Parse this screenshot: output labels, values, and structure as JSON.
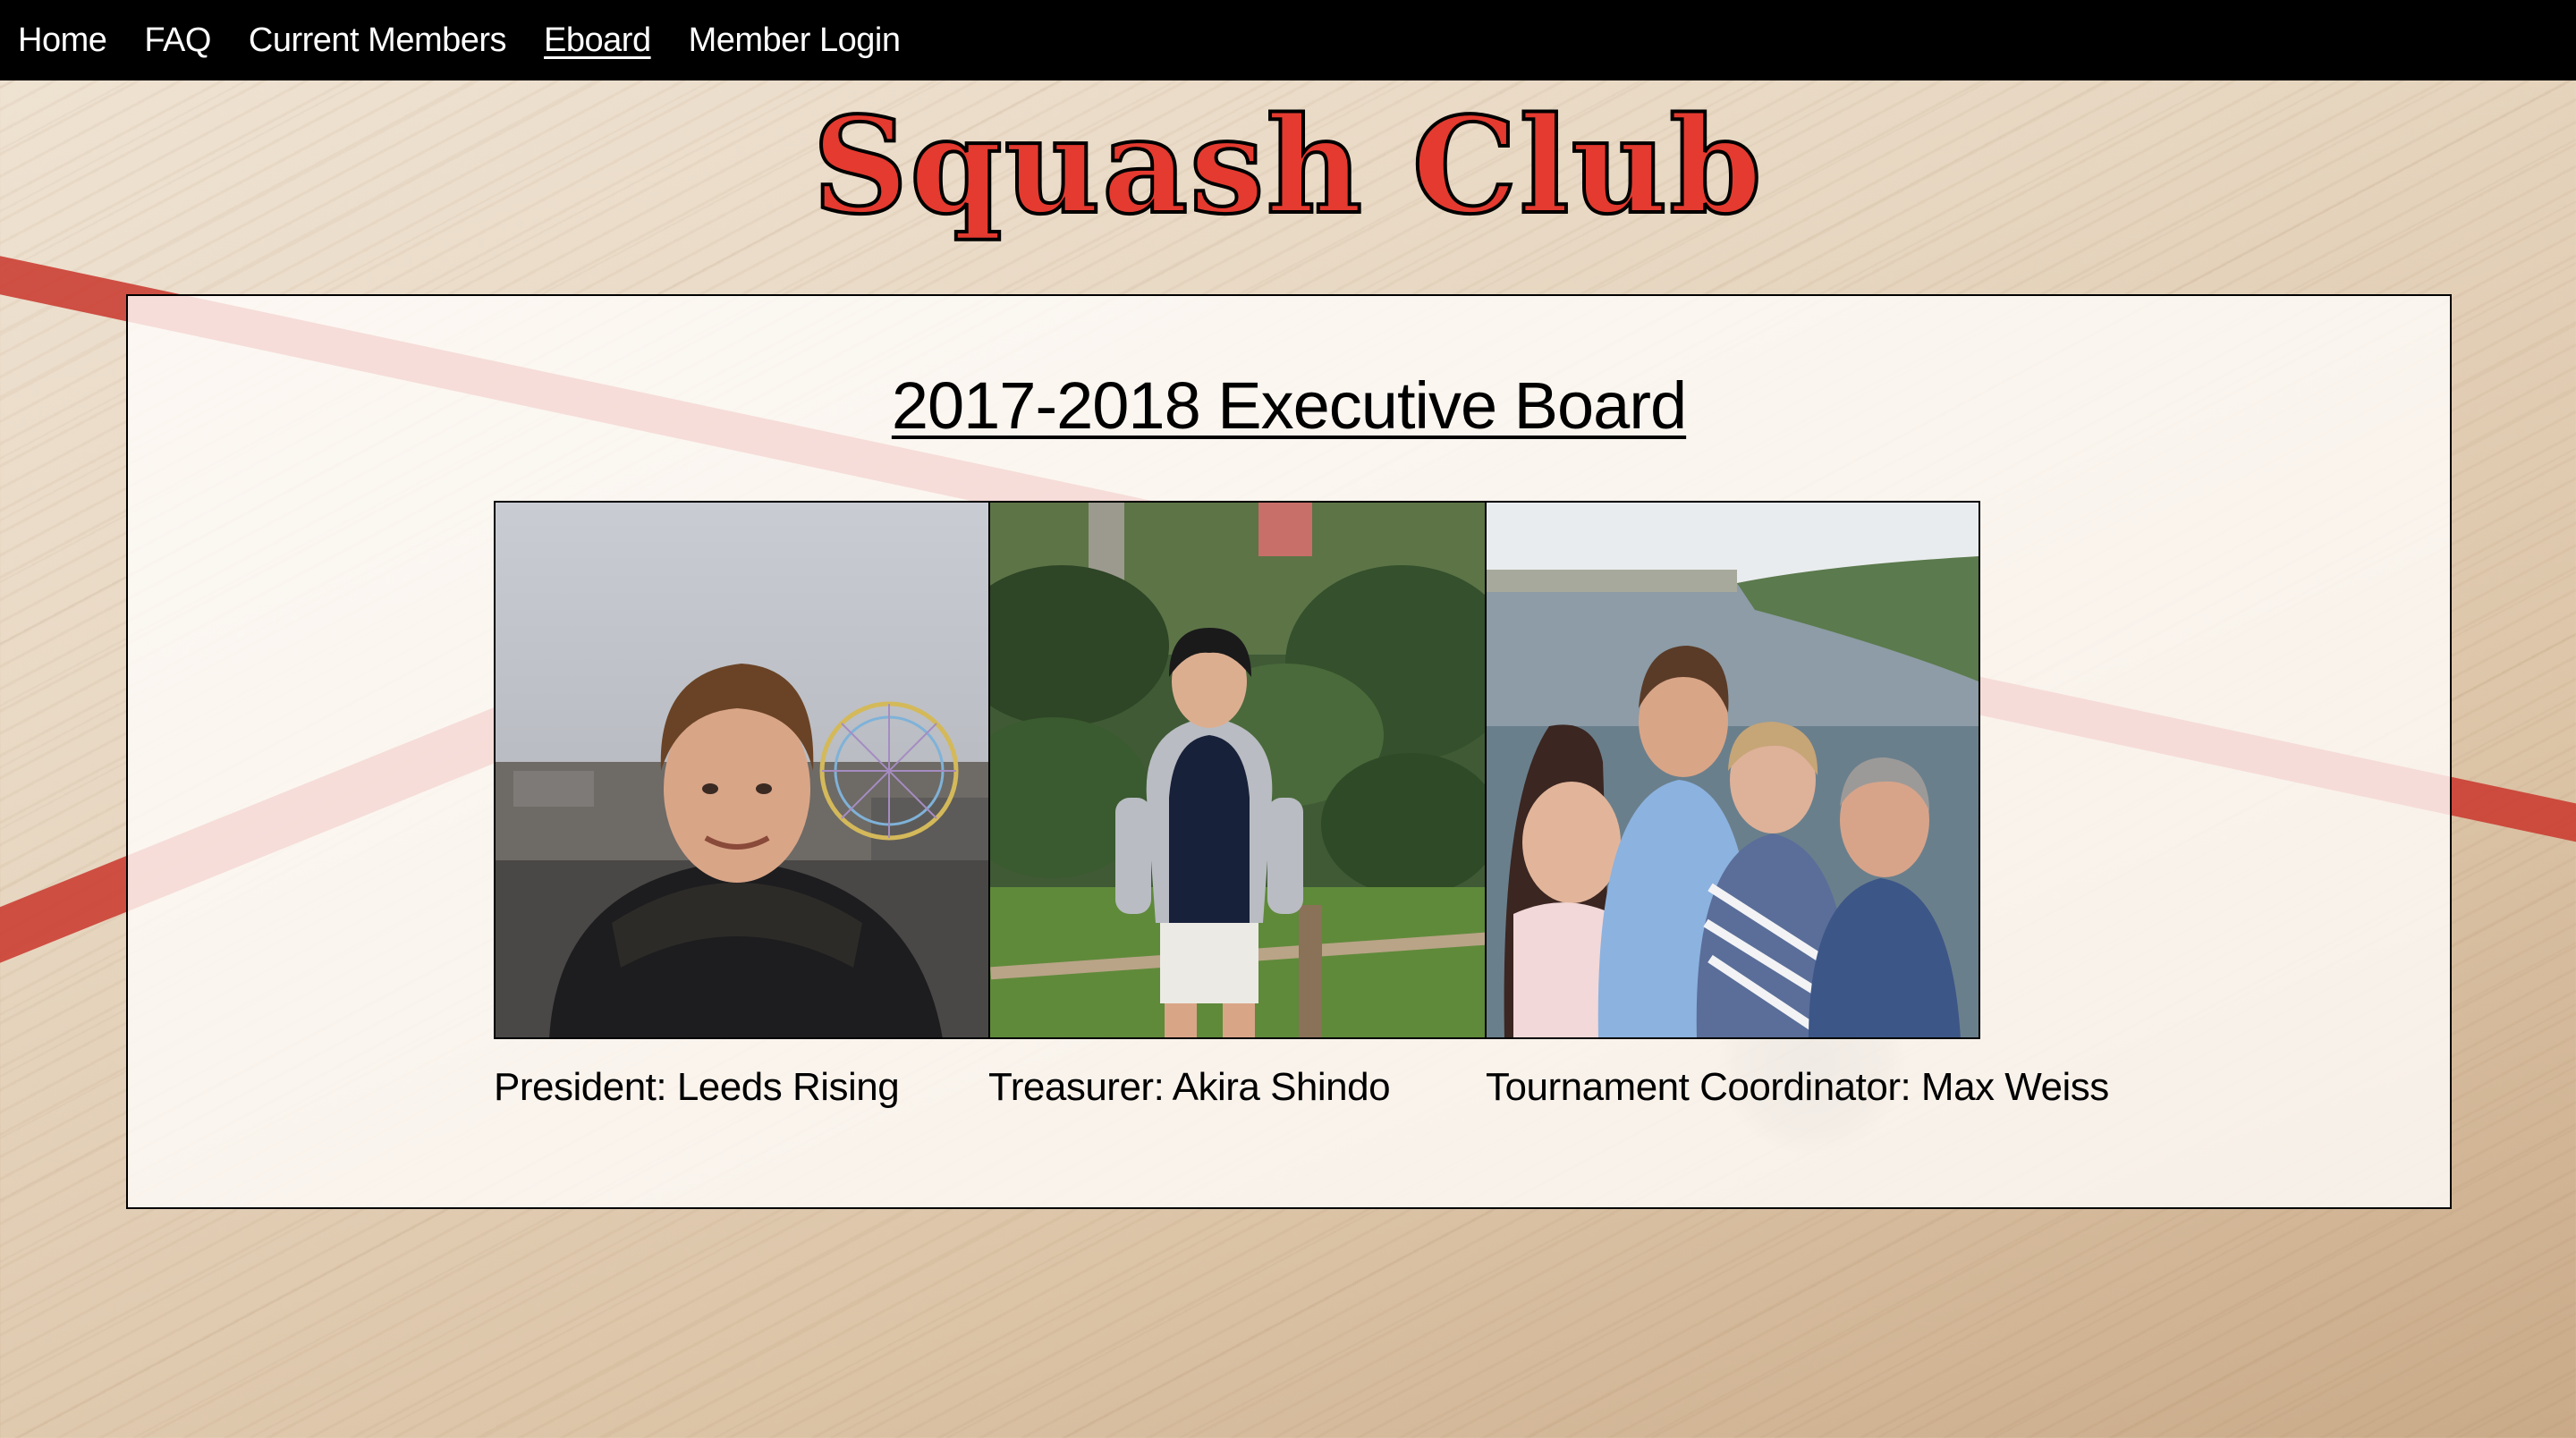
{
  "nav": {
    "items": [
      {
        "label": "Home",
        "active": false
      },
      {
        "label": "FAQ",
        "active": false
      },
      {
        "label": "Current Members",
        "active": false
      },
      {
        "label": "Eboard",
        "active": true
      },
      {
        "label": "Member Login",
        "active": false
      }
    ]
  },
  "site_title": "Squash Club",
  "board": {
    "heading": "2017-2018 Executive Board",
    "members": [
      {
        "caption": "President: Leeds Rising"
      },
      {
        "caption": "Treasurer: Akira Shindo"
      },
      {
        "caption": "Tournament Coordinator: Max Weiss"
      }
    ]
  },
  "colors": {
    "nav_bg": "#000000",
    "title_red": "#e53a2f",
    "court_line": "#c9362c"
  }
}
